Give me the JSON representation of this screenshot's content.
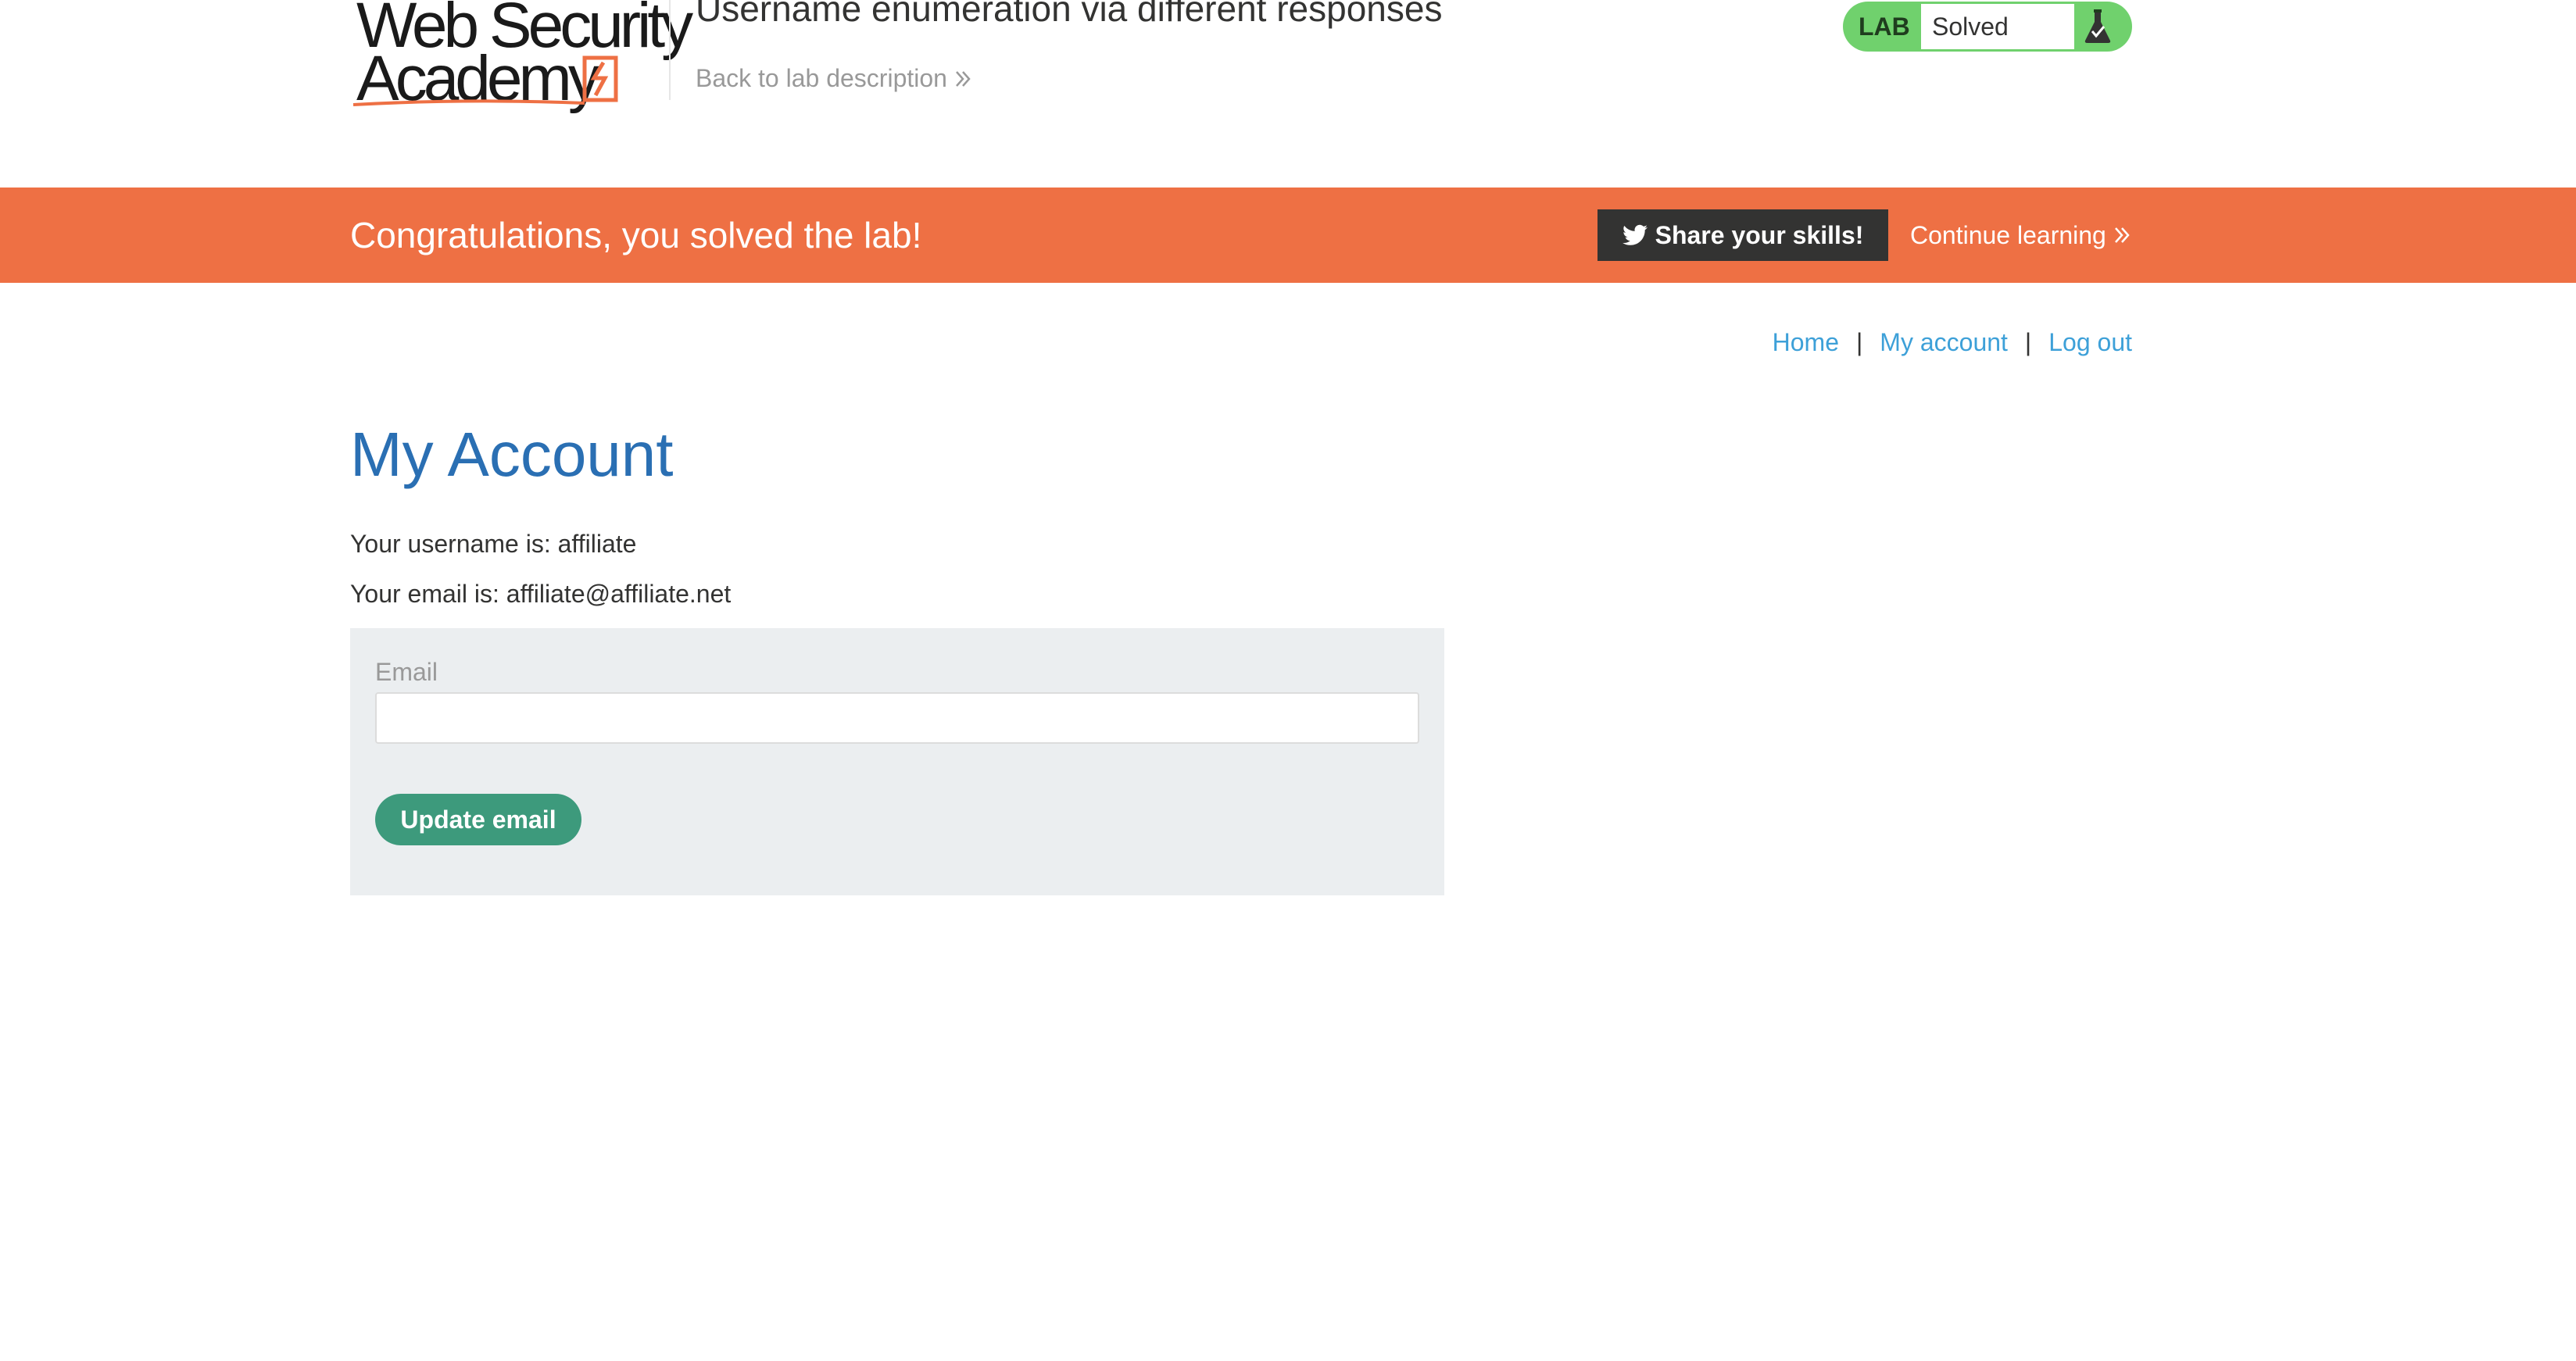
{
  "header": {
    "logo_line1": "Web Security",
    "logo_line2": "Academy",
    "lab_title": "Username enumeration via different responses",
    "back_link": "Back to lab description",
    "lab_status": {
      "label": "LAB",
      "value": "Solved",
      "accent_color": "#70d16d"
    }
  },
  "banner": {
    "message": "Congratulations, you solved the lab!",
    "share_button": "Share your skills!",
    "continue_link": "Continue learning",
    "background_color": "#ee7044"
  },
  "nav": {
    "home": "Home",
    "separator": "|",
    "my_account": "My account",
    "log_out": "Log out"
  },
  "main": {
    "title": "My Account",
    "username_line": "Your username is: affiliate",
    "email_line": "Your email is: affiliate@affiliate.net",
    "form": {
      "email_label": "Email",
      "email_value": "",
      "submit_label": "Update email",
      "button_color": "#3d9a7c"
    }
  },
  "icons": {
    "twitter": "twitter-icon",
    "flask": "flask-icon",
    "chevron": "double-chevron-right-icon"
  }
}
